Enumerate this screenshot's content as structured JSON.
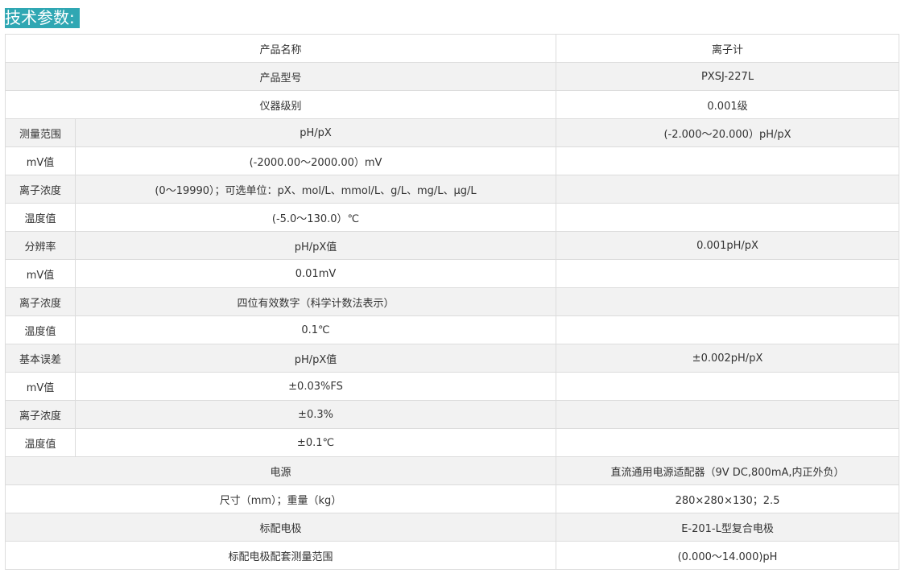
{
  "heading": "技术参数:",
  "rows": [
    {
      "full": "产品名称",
      "value": "离子计"
    },
    {
      "full": "产品型号",
      "value": "PXSJ-227L"
    },
    {
      "full": "仪器级别",
      "value": "0.001级"
    },
    {
      "group": "测量范围",
      "label": "pH/pX",
      "value": "(-2.000～20.000）pH/pX"
    },
    {
      "group": "mV值",
      "label": "(-2000.00～2000.00）mV",
      "value": ""
    },
    {
      "group": "离子浓度",
      "label": "(0～19990）；可选单位：pX、mol/L、mmol/L、g/L、mg/L、μg/L",
      "value": ""
    },
    {
      "group": "温度值",
      "label": "(-5.0～130.0）℃",
      "value": ""
    },
    {
      "group": "分辨率",
      "label": "pH/pX值",
      "value": "0.001pH/pX"
    },
    {
      "group": "mV值",
      "label": "0.01mV",
      "value": ""
    },
    {
      "group": "离子浓度",
      "label": "四位有效数字（科学计数法表示）",
      "value": ""
    },
    {
      "group": "温度值",
      "label": "0.1℃",
      "value": ""
    },
    {
      "group": "基本误差",
      "label": "pH/pX值",
      "value": "±0.002pH/pX"
    },
    {
      "group": "mV值",
      "label": "±0.03%FS",
      "value": ""
    },
    {
      "group": "离子浓度",
      "label": "±0.3%",
      "value": ""
    },
    {
      "group": "温度值",
      "label": "±0.1℃",
      "value": ""
    },
    {
      "full": "电源",
      "value": "直流通用电源适配器（9V DC,800mA,内正外负）"
    },
    {
      "full": "尺寸（mm）；重量（kg）",
      "value": "280×280×130；2.5"
    },
    {
      "full": "标配电极",
      "value": "E-201-L型复合电极"
    },
    {
      "full": "标配电极配套测量范围",
      "value": "(0.000～14.000)pH"
    }
  ]
}
